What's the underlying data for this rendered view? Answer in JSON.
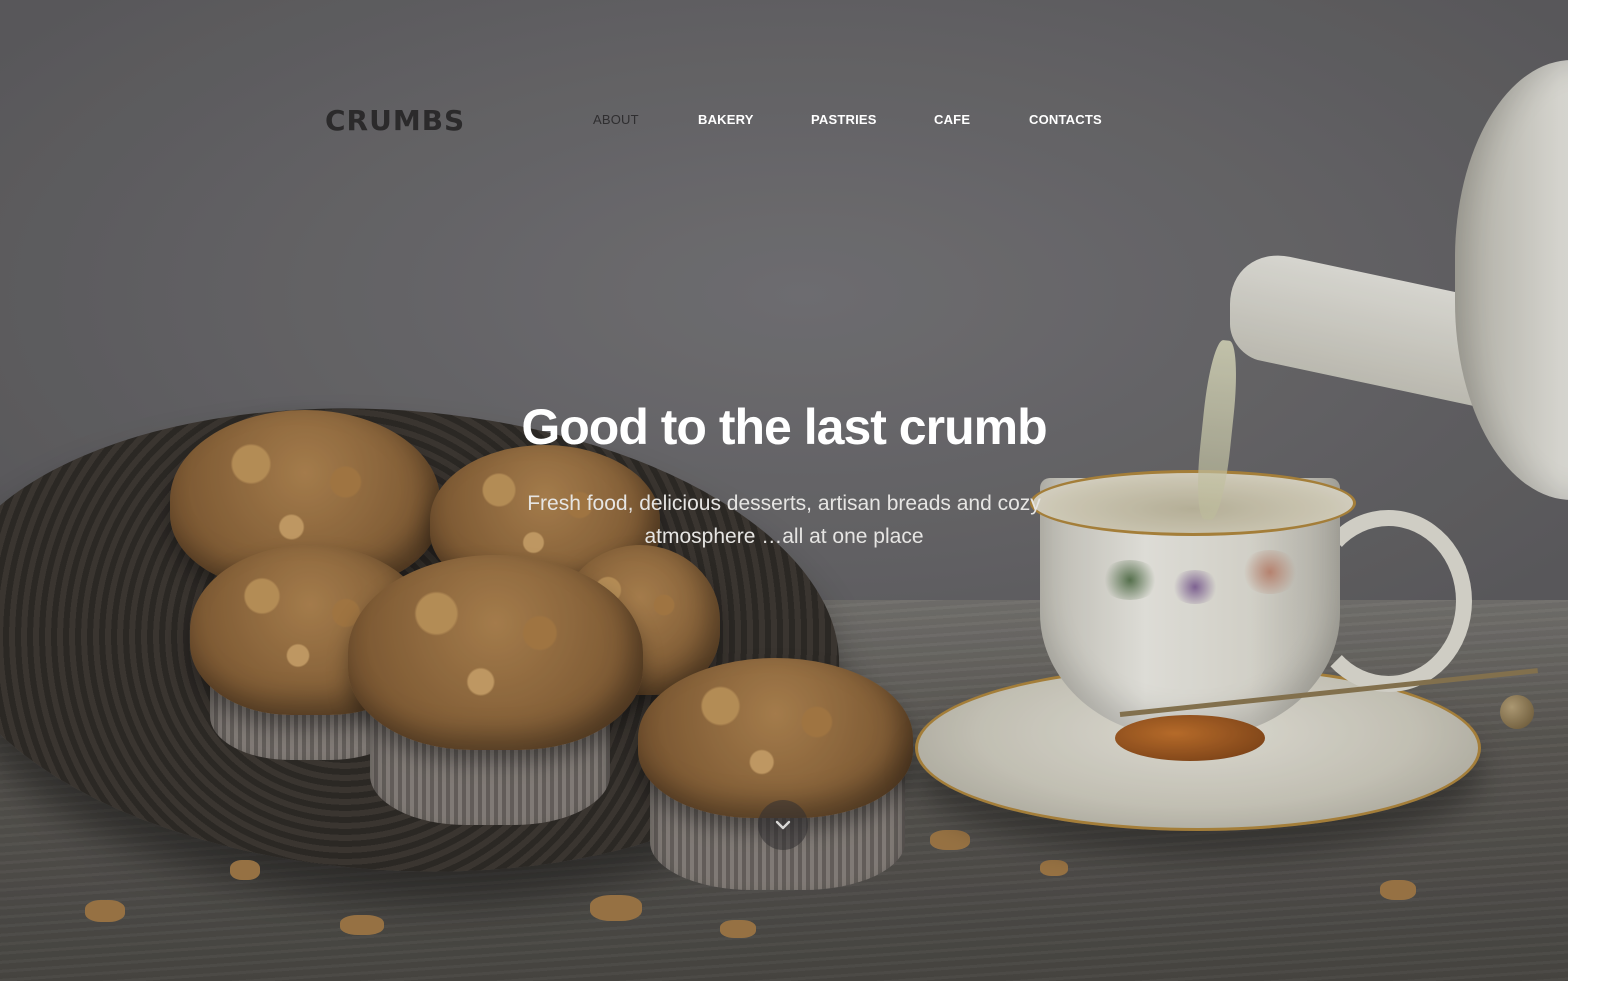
{
  "brand": {
    "logo_text": "CRUMBS"
  },
  "nav": {
    "items": [
      {
        "label": "ABOUT",
        "active": true
      },
      {
        "label": "BAKERY",
        "active": false
      },
      {
        "label": "PASTRIES",
        "active": false
      },
      {
        "label": "CAFE",
        "active": false
      },
      {
        "label": "CONTACTS",
        "active": false
      }
    ]
  },
  "hero": {
    "title": "Good to the last crumb",
    "subtitle_line1": "Fresh food, delicious desserts, artisan breads and cozy",
    "subtitle_line2": "atmosphere …all at one place",
    "scroll_icon": "chevron-down-icon"
  },
  "colors": {
    "nav_text": "#ffffff",
    "nav_active": "#2f2e30",
    "background": "#6c6b6e"
  }
}
